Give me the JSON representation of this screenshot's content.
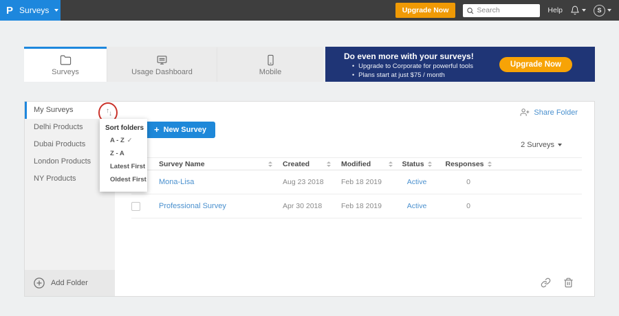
{
  "topbar": {
    "logo_letter": "P",
    "product_menu": "Surveys",
    "upgrade_label": "Upgrade Now",
    "search_placeholder": "Search",
    "help_label": "Help",
    "avatar_letter": "S"
  },
  "tabs": [
    {
      "label": "Surveys",
      "active": true
    },
    {
      "label": "Usage Dashboard",
      "active": false
    },
    {
      "label": "Mobile",
      "active": false
    }
  ],
  "promo": {
    "title": "Do even more with your surveys!",
    "bullet_glyph": "•",
    "bullets": [
      "Upgrade to Corporate for powerful tools",
      "Plans start at just $75 / month"
    ],
    "cta_label": "Upgrade Now"
  },
  "sidebar": {
    "items": [
      {
        "label": "My Surveys",
        "active": true
      },
      {
        "label": "Delhi Products",
        "active": false
      },
      {
        "label": "Dubai Products",
        "active": false
      },
      {
        "label": "London Products",
        "active": false
      },
      {
        "label": "NY Products",
        "active": false
      }
    ],
    "add_folder_label": "Add Folder"
  },
  "sort_menu": {
    "title": "Sort folders",
    "checkmark": "✓",
    "sort_glyph_up": "↑",
    "sort_glyph_down": "↓",
    "options": [
      {
        "label": "A - Z",
        "selected": true
      },
      {
        "label": "Z - A",
        "selected": false
      },
      {
        "label": "Latest First",
        "selected": false
      },
      {
        "label": "Oldest First",
        "selected": false
      }
    ]
  },
  "toolbar": {
    "new_survey_plus": "+",
    "new_survey_label": "New Survey",
    "share_folder_label": "Share Folder",
    "count_label": "2 Surveys"
  },
  "table": {
    "columns": [
      "Survey Name",
      "Created",
      "Modified",
      "Status",
      "Responses"
    ],
    "rows": [
      {
        "name": "Mona-Lisa",
        "created": "Aug 23 2018",
        "modified": "Feb 18 2019",
        "status": "Active",
        "responses": "0"
      },
      {
        "name": "Professional Survey",
        "created": "Apr 30 2018",
        "modified": "Feb 18 2019",
        "status": "Active",
        "responses": "0"
      }
    ]
  },
  "colors": {
    "topbar_bg": "#3e3e3e",
    "brand_blue": "#1d87dd",
    "button_blue": "#1e88d9",
    "link_blue": "#4a90ce",
    "orange": "#f09a05",
    "promo_navy": "#1f3576",
    "promo_orange": "#f7a306",
    "annotation_red": "#cb332b",
    "active_status": "#4a90ce"
  }
}
